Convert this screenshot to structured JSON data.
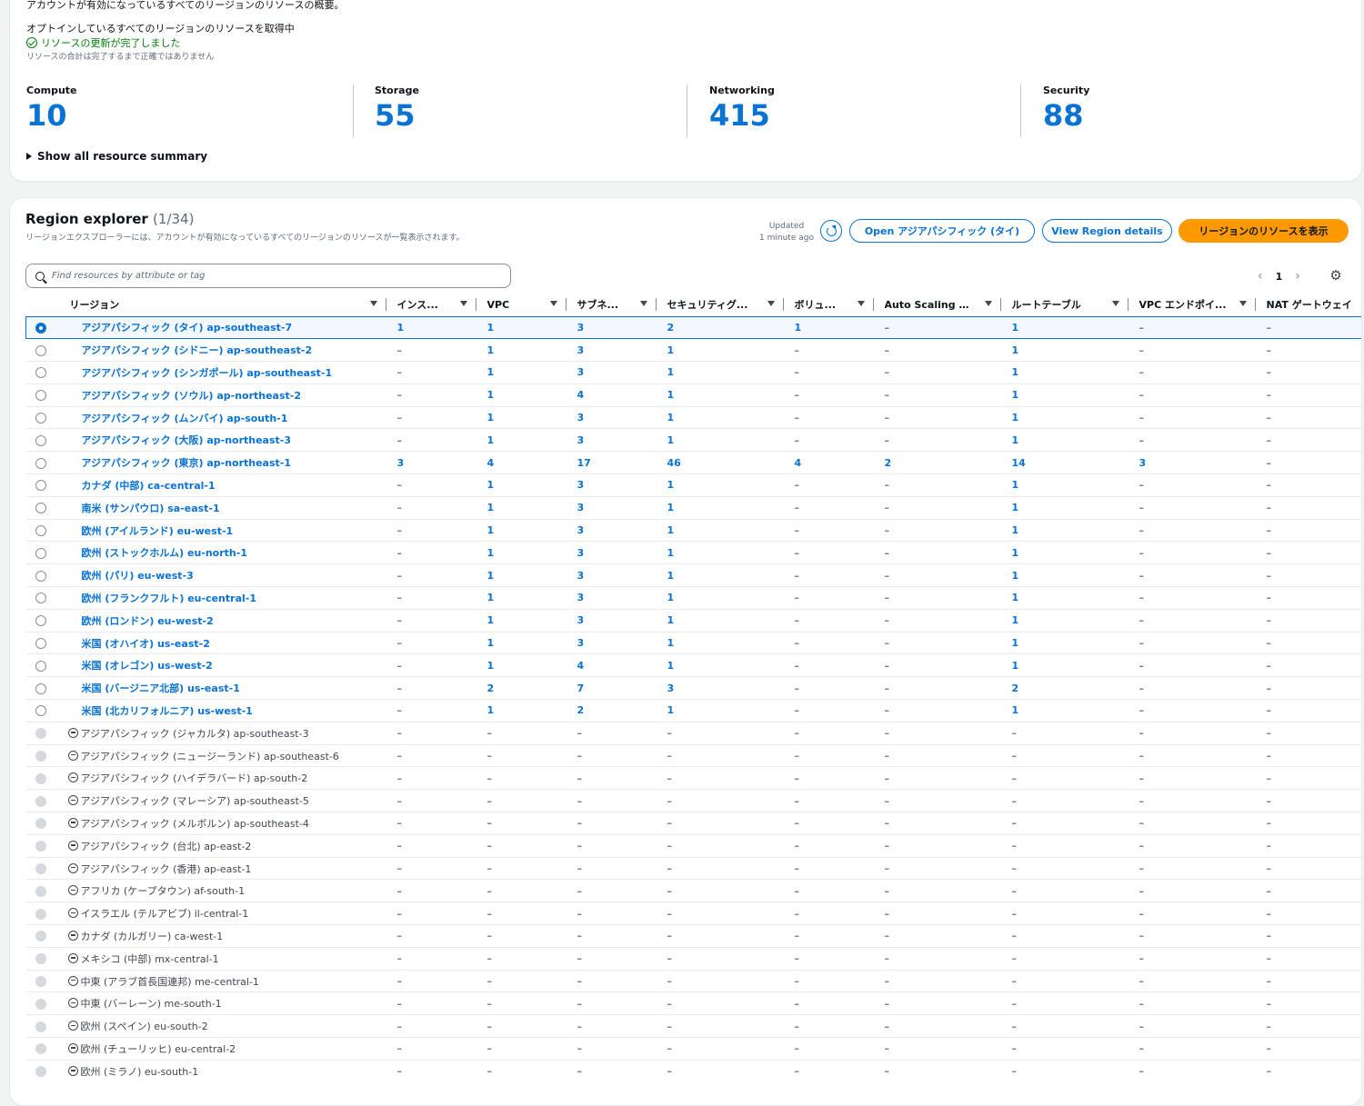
{
  "summary": {
    "description": "アカウントが有効になっているすべてのリージョンのリソースの概要。",
    "fetching": "オプトインしているすべてのリージョンのリソースを取得中",
    "status": "リソースの更新が完了しました",
    "note": "リソースの合計は完了するまで正確ではありません",
    "metrics": [
      {
        "label": "Compute",
        "value": "10"
      },
      {
        "label": "Storage",
        "value": "55"
      },
      {
        "label": "Networking",
        "value": "415"
      },
      {
        "label": "Security",
        "value": "88"
      }
    ],
    "show_all": "Show all resource summary"
  },
  "explorer": {
    "title": "Region explorer",
    "count": "(1/34)",
    "description": "リージョンエクスプローラーには、アカウントが有効になっているすべてのリージョンのリソースが一覧表示されます。",
    "updated_label": "Updated",
    "updated_time": "1 minute ago",
    "open_button": "Open アジアパシフィック (タイ)",
    "details_button": "View Region details",
    "primary_button": "リージョンのリソースを表示",
    "search_placeholder": "Find resources by attribute or tag",
    "page": "1",
    "columns": [
      "リージョン",
      "インス...",
      "VPC",
      "サブネ...",
      "セキュリティグ...",
      "ボリュ...",
      "Auto Scaling グ...",
      "ルートテーブル",
      "VPC エンドポイ...",
      "NAT ゲートウェイ"
    ],
    "rows": [
      {
        "region": "アジアパシフィック (タイ) ap-southeast-7",
        "enabled": true,
        "selected": true,
        "values": [
          "1",
          "1",
          "3",
          "2",
          "1",
          "–",
          "1",
          "–",
          "–"
        ]
      },
      {
        "region": "アジアパシフィック (シドニー) ap-southeast-2",
        "enabled": true,
        "values": [
          "–",
          "1",
          "3",
          "1",
          "–",
          "–",
          "1",
          "–",
          "–"
        ]
      },
      {
        "region": "アジアパシフィック (シンガポール) ap-southeast-1",
        "enabled": true,
        "values": [
          "–",
          "1",
          "3",
          "1",
          "–",
          "–",
          "1",
          "–",
          "–"
        ]
      },
      {
        "region": "アジアパシフィック (ソウル) ap-northeast-2",
        "enabled": true,
        "values": [
          "–",
          "1",
          "4",
          "1",
          "–",
          "–",
          "1",
          "–",
          "–"
        ]
      },
      {
        "region": "アジアパシフィック (ムンバイ) ap-south-1",
        "enabled": true,
        "values": [
          "–",
          "1",
          "3",
          "1",
          "–",
          "–",
          "1",
          "–",
          "–"
        ]
      },
      {
        "region": "アジアパシフィック (大阪) ap-northeast-3",
        "enabled": true,
        "values": [
          "–",
          "1",
          "3",
          "1",
          "–",
          "–",
          "1",
          "–",
          "–"
        ]
      },
      {
        "region": "アジアパシフィック (東京) ap-northeast-1",
        "enabled": true,
        "values": [
          "3",
          "4",
          "17",
          "46",
          "4",
          "2",
          "14",
          "3",
          "–"
        ]
      },
      {
        "region": "カナダ (中部) ca-central-1",
        "enabled": true,
        "values": [
          "–",
          "1",
          "3",
          "1",
          "–",
          "–",
          "1",
          "–",
          "–"
        ]
      },
      {
        "region": "南米 (サンパウロ) sa-east-1",
        "enabled": true,
        "values": [
          "–",
          "1",
          "3",
          "1",
          "–",
          "–",
          "1",
          "–",
          "–"
        ]
      },
      {
        "region": "欧州 (アイルランド) eu-west-1",
        "enabled": true,
        "values": [
          "–",
          "1",
          "3",
          "1",
          "–",
          "–",
          "1",
          "–",
          "–"
        ]
      },
      {
        "region": "欧州 (ストックホルム) eu-north-1",
        "enabled": true,
        "values": [
          "–",
          "1",
          "3",
          "1",
          "–",
          "–",
          "1",
          "–",
          "–"
        ]
      },
      {
        "region": "欧州 (パリ) eu-west-3",
        "enabled": true,
        "values": [
          "–",
          "1",
          "3",
          "1",
          "–",
          "–",
          "1",
          "–",
          "–"
        ]
      },
      {
        "region": "欧州 (フランクフルト) eu-central-1",
        "enabled": true,
        "values": [
          "–",
          "1",
          "3",
          "1",
          "–",
          "–",
          "1",
          "–",
          "–"
        ]
      },
      {
        "region": "欧州 (ロンドン) eu-west-2",
        "enabled": true,
        "values": [
          "–",
          "1",
          "3",
          "1",
          "–",
          "–",
          "1",
          "–",
          "–"
        ]
      },
      {
        "region": "米国 (オハイオ) us-east-2",
        "enabled": true,
        "values": [
          "–",
          "1",
          "3",
          "1",
          "–",
          "–",
          "1",
          "–",
          "–"
        ]
      },
      {
        "region": "米国 (オレゴン) us-west-2",
        "enabled": true,
        "values": [
          "–",
          "1",
          "4",
          "1",
          "–",
          "–",
          "1",
          "–",
          "–"
        ]
      },
      {
        "region": "米国 (バージニア北部) us-east-1",
        "enabled": true,
        "values": [
          "–",
          "2",
          "7",
          "3",
          "–",
          "–",
          "2",
          "–",
          "–"
        ]
      },
      {
        "region": "米国 (北カリフォルニア) us-west-1",
        "enabled": true,
        "values": [
          "–",
          "1",
          "2",
          "1",
          "–",
          "–",
          "1",
          "–",
          "–"
        ]
      },
      {
        "region": "アジアパシフィック (ジャカルタ) ap-southeast-3",
        "enabled": false,
        "values": [
          "–",
          "–",
          "–",
          "–",
          "–",
          "–",
          "–",
          "–",
          "–"
        ]
      },
      {
        "region": "アジアパシフィック (ニュージーランド) ap-southeast-6",
        "enabled": false,
        "values": [
          "–",
          "–",
          "–",
          "–",
          "–",
          "–",
          "–",
          "–",
          "–"
        ]
      },
      {
        "region": "アジアパシフィック (ハイデラバード) ap-south-2",
        "enabled": false,
        "values": [
          "–",
          "–",
          "–",
          "–",
          "–",
          "–",
          "–",
          "–",
          "–"
        ]
      },
      {
        "region": "アジアパシフィック (マレーシア) ap-southeast-5",
        "enabled": false,
        "values": [
          "–",
          "–",
          "–",
          "–",
          "–",
          "–",
          "–",
          "–",
          "–"
        ]
      },
      {
        "region": "アジアパシフィック (メルボルン) ap-southeast-4",
        "enabled": false,
        "values": [
          "–",
          "–",
          "–",
          "–",
          "–",
          "–",
          "–",
          "–",
          "–"
        ]
      },
      {
        "region": "アジアパシフィック (台北) ap-east-2",
        "enabled": false,
        "values": [
          "–",
          "–",
          "–",
          "–",
          "–",
          "–",
          "–",
          "–",
          "–"
        ]
      },
      {
        "region": "アジアパシフィック (香港) ap-east-1",
        "enabled": false,
        "values": [
          "–",
          "–",
          "–",
          "–",
          "–",
          "–",
          "–",
          "–",
          "–"
        ]
      },
      {
        "region": "アフリカ (ケープタウン) af-south-1",
        "enabled": false,
        "values": [
          "–",
          "–",
          "–",
          "–",
          "–",
          "–",
          "–",
          "–",
          "–"
        ]
      },
      {
        "region": "イスラエル (テルアビブ) il-central-1",
        "enabled": false,
        "values": [
          "–",
          "–",
          "–",
          "–",
          "–",
          "–",
          "–",
          "–",
          "–"
        ]
      },
      {
        "region": "カナダ (カルガリー) ca-west-1",
        "enabled": false,
        "values": [
          "–",
          "–",
          "–",
          "–",
          "–",
          "–",
          "–",
          "–",
          "–"
        ]
      },
      {
        "region": "メキシコ (中部) mx-central-1",
        "enabled": false,
        "values": [
          "–",
          "–",
          "–",
          "–",
          "–",
          "–",
          "–",
          "–",
          "–"
        ]
      },
      {
        "region": "中東 (アラブ首長国連邦) me-central-1",
        "enabled": false,
        "values": [
          "–",
          "–",
          "–",
          "–",
          "–",
          "–",
          "–",
          "–",
          "–"
        ]
      },
      {
        "region": "中東 (バーレーン) me-south-1",
        "enabled": false,
        "values": [
          "–",
          "–",
          "–",
          "–",
          "–",
          "–",
          "–",
          "–",
          "–"
        ]
      },
      {
        "region": "欧州 (スペイン) eu-south-2",
        "enabled": false,
        "values": [
          "–",
          "–",
          "–",
          "–",
          "–",
          "–",
          "–",
          "–",
          "–"
        ]
      },
      {
        "region": "欧州 (チューリッヒ) eu-central-2",
        "enabled": false,
        "values": [
          "–",
          "–",
          "–",
          "–",
          "–",
          "–",
          "–",
          "–",
          "–"
        ]
      },
      {
        "region": "欧州 (ミラノ) eu-south-1",
        "enabled": false,
        "values": [
          "–",
          "–",
          "–",
          "–",
          "–",
          "–",
          "–",
          "–",
          "–"
        ]
      }
    ]
  },
  "colors": {
    "link": "#0972d3",
    "primary_button": "#ff9900",
    "success": "#037f0c"
  },
  "icons": [
    "check-circle-icon",
    "caret-right-icon",
    "refresh-icon",
    "search-icon",
    "chevron-left-icon",
    "chevron-right-icon",
    "gear-icon",
    "sort-caret-icon",
    "disabled-region-icon"
  ]
}
